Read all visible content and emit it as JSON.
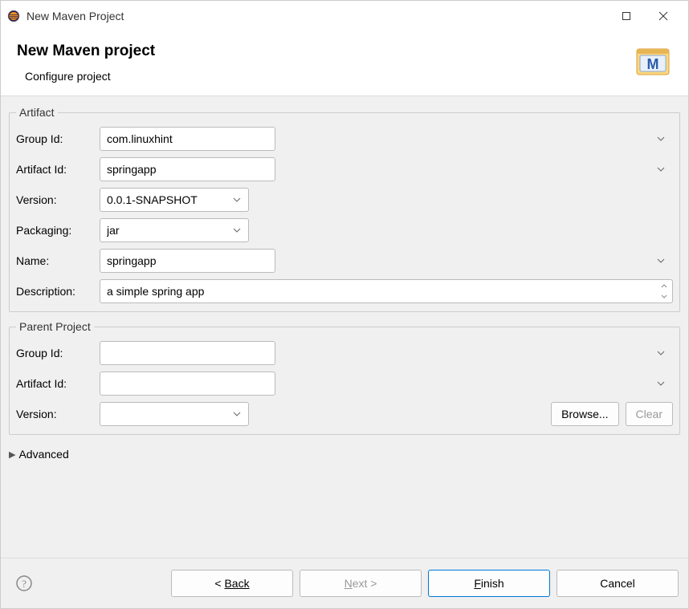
{
  "titlebar": {
    "title": "New Maven Project"
  },
  "header": {
    "title": "New Maven project",
    "subtitle": "Configure project"
  },
  "artifact": {
    "legend": "Artifact",
    "groupIdLabel": "Group Id:",
    "groupIdValue": "com.linuxhint",
    "artifactIdLabel": "Artifact Id:",
    "artifactIdValue": "springapp",
    "versionLabel": "Version:",
    "versionValue": "0.0.1-SNAPSHOT",
    "packagingLabel": "Packaging:",
    "packagingValue": "jar",
    "nameLabel": "Name:",
    "nameValue": "springapp",
    "descriptionLabel": "Description:",
    "descriptionValue": "a simple spring app"
  },
  "parent": {
    "legend": "Parent Project",
    "groupIdLabel": "Group Id:",
    "groupIdValue": "",
    "artifactIdLabel": "Artifact Id:",
    "artifactIdValue": "",
    "versionLabel": "Version:",
    "versionValue": "",
    "browseLabel": "Browse...",
    "clearLabel": "Clear"
  },
  "advanced": {
    "label": "Advanced"
  },
  "buttons": {
    "back": "Back",
    "next": "Next >",
    "finish": "Finish",
    "cancel": "Cancel"
  }
}
